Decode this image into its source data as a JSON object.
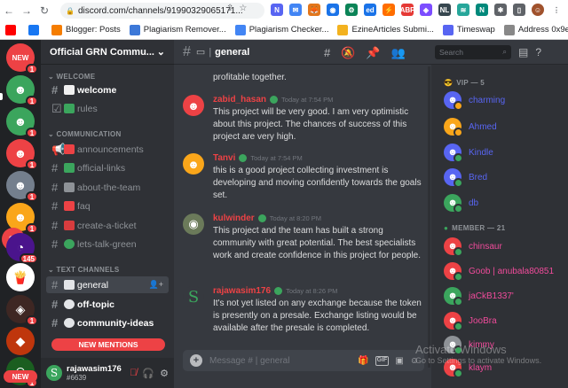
{
  "browser": {
    "url": "discord.com/channels/91990329065171...",
    "bookmarks": [
      {
        "label": "",
        "color": "#ff0000"
      },
      {
        "label": "",
        "color": "#1877f2"
      },
      {
        "label": "Blogger: Posts",
        "color": "#f57d00"
      },
      {
        "label": "Plagiarism Remover...",
        "color": "#3c78d8"
      },
      {
        "label": "Plagiarism Checker...",
        "color": "#4285f4"
      },
      {
        "label": "EzineArticles Submi...",
        "color": "#f3b21f"
      },
      {
        "label": "Timeswap",
        "color": "#5865f2"
      },
      {
        "label": "Address 0x9ea5150...",
        "color": "#888888"
      }
    ]
  },
  "server": {
    "name": "Official GRN Commu...",
    "categories": {
      "welcome": "WELCOME",
      "communication": "COMMUNICATION",
      "text": "TEXT CHANNELS"
    },
    "channels_welcome": [
      {
        "label": "welcome",
        "emoji_color": "#f0f0f0",
        "unread": true
      },
      {
        "label": "rules",
        "emoji_color": "#3ba55d",
        "unread": false
      }
    ],
    "channels_comm": [
      {
        "label": "announcements",
        "emoji_color": "#ed4245"
      },
      {
        "label": "official-links",
        "emoji_color": "#3ba55d"
      },
      {
        "label": "about-the-team",
        "emoji_color": "#8e9297"
      },
      {
        "label": "faq",
        "emoji_color": "#ed4245"
      },
      {
        "label": "create-a-ticket",
        "emoji_color": "#d83c3e"
      },
      {
        "label": "lets-talk-green",
        "emoji_color": "#3ba55d"
      }
    ],
    "channels_text": [
      {
        "label": "general",
        "active": true
      },
      {
        "label": "off-topic",
        "active": false
      },
      {
        "label": "community-ideas",
        "active": false
      }
    ],
    "new_mentions": "NEW MENTIONS"
  },
  "guilds": {
    "new_label": "NEW",
    "badges": [
      "1",
      "1",
      "1",
      "1",
      "1",
      "1",
      "86",
      "145",
      "1",
      "1"
    ]
  },
  "user": {
    "name": "rajawasim176",
    "tag": "#6639"
  },
  "chat": {
    "channel": "general",
    "first_line": "profitable together.",
    "messages": [
      {
        "name": "zabid_hasan",
        "name_color": "#ed4245",
        "time": "Today at 7:54 PM",
        "avatar_color": "#ed4245",
        "text": "This project will be very good. I am very optimistic about this project. The chances of success of this project are very high."
      },
      {
        "name": "Tanvi",
        "name_color": "#ed4245",
        "time": "Today at 7:54 PM",
        "avatar_color": "#faa61a",
        "text": "this is a good project collecting investment is developing and moving confidently towards the goals set."
      },
      {
        "name": "kulwinder",
        "name_color": "#ed4245",
        "time": "Today at 8:20 PM",
        "avatar_color": "#6b7a5a",
        "text": "This project and the team has built a strong community with great potential. The best specialists work and create confidence in this project for people."
      },
      {
        "name": "rajawasim176",
        "name_color": "#ed4245",
        "time": "Today at 8:26 PM",
        "avatar_color": "#36393f",
        "text": "It's not yet listed on any exchange  because the token is presently on a presale. Exchange listing would be available after the presale is completed."
      }
    ],
    "composer_placeholder": "Message #  | general"
  },
  "members": {
    "search_placeholder": "Search",
    "vip_header": "VIP — 5",
    "vip": [
      {
        "name": "charming",
        "color": "#5865f2",
        "avatar_color": "#5865f2"
      },
      {
        "name": "Ahmed",
        "color": "#5865f2",
        "avatar_color": "#faa61a"
      },
      {
        "name": "Kindle",
        "color": "#5865f2",
        "avatar_color": "#5865f2"
      },
      {
        "name": "Bred",
        "color": "#5865f2",
        "avatar_color": "#5865f2"
      },
      {
        "name": "db",
        "color": "#5865f2",
        "avatar_color": "#3ba55d"
      }
    ],
    "member_header": "MEMBER — 21",
    "list": [
      {
        "name": "chinsaur",
        "color": "#f04b9b",
        "avatar_color": "#ed4245"
      },
      {
        "name": "Goob | anubala80851",
        "color": "#f04b9b",
        "avatar_color": "#ed4245"
      },
      {
        "name": "jaCkB1337'",
        "color": "#f04b9b",
        "avatar_color": "#3ba55d"
      },
      {
        "name": "JooBra",
        "color": "#f04b9b",
        "avatar_color": "#ed4245"
      },
      {
        "name": "kimmy",
        "color": "#f04b9b",
        "avatar_color": "#8e9297"
      },
      {
        "name": "klaym",
        "color": "#f04b9b",
        "avatar_color": "#ed4245"
      }
    ]
  },
  "watermark": {
    "line1": "Activate Windows",
    "line2": "Go to Settings to activate Windows."
  }
}
